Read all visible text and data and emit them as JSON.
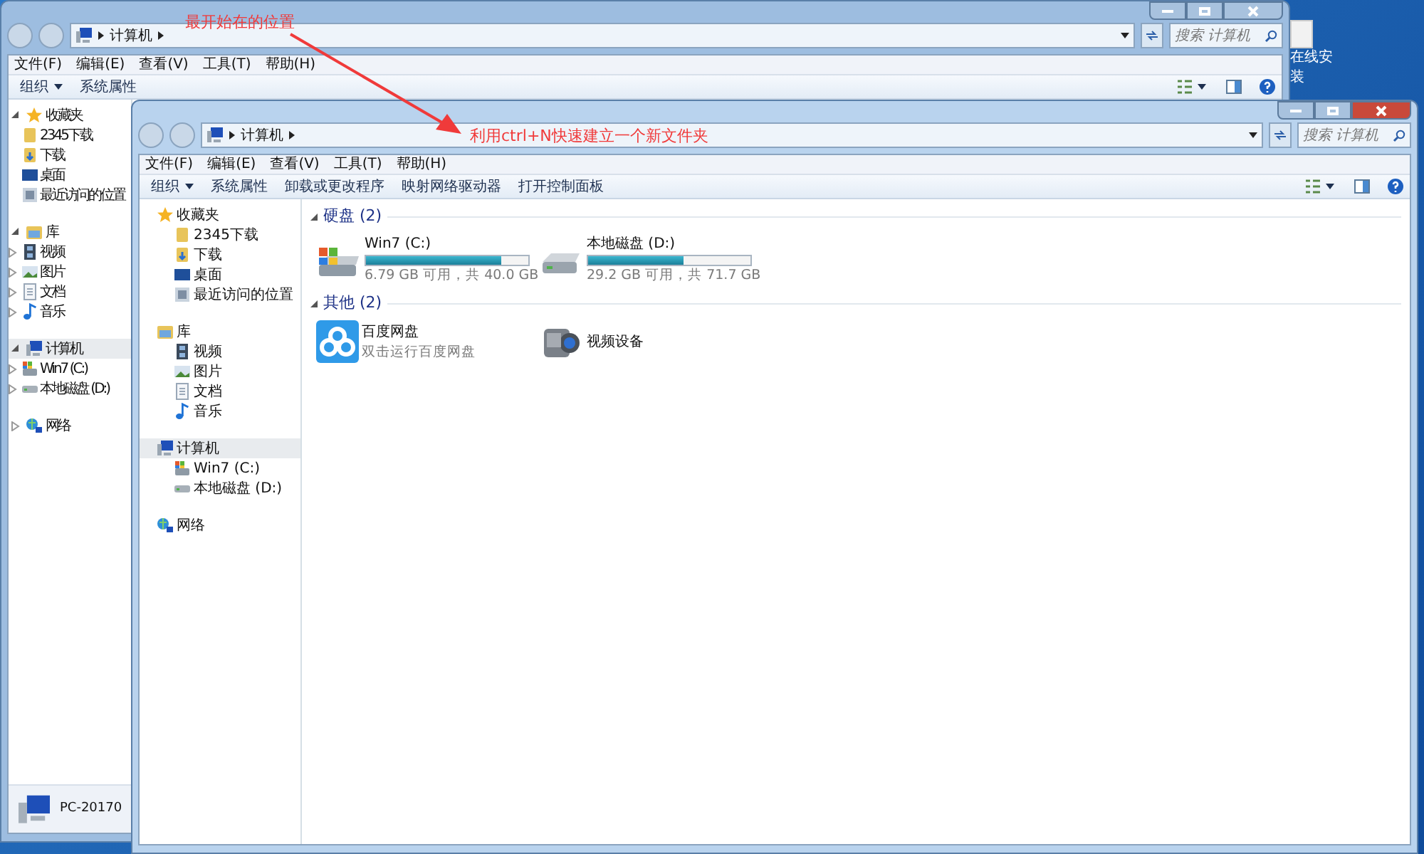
{
  "desktop_icons": [
    {
      "label": "在线安装"
    }
  ],
  "windows": [
    {
      "active": false,
      "address": [
        "计算机"
      ],
      "search": {
        "placeholder": "搜索 计算机"
      },
      "menu": [
        "文件(F)",
        "编辑(E)",
        "查看(V)",
        "工具(T)",
        "帮助(H)"
      ],
      "toolbar": [
        {
          "label": "组织",
          "dropdown": true
        },
        {
          "label": "系统属性",
          "dropdown": false
        }
      ],
      "sidebar": [
        {
          "label": "收藏夹",
          "kind": "star",
          "expanded": true,
          "selected": false,
          "children": [
            {
              "label": "2345下载",
              "kind": "folder"
            },
            {
              "label": "下载",
              "kind": "download"
            },
            {
              "label": "桌面",
              "kind": "desktop"
            },
            {
              "label": "最近访问的位置",
              "kind": "recent"
            }
          ]
        },
        {
          "label": "库",
          "kind": "library",
          "expanded": true,
          "selected": false,
          "children": [
            {
              "label": "视频",
              "kind": "video",
              "expanded": false
            },
            {
              "label": "图片",
              "kind": "image",
              "expanded": false
            },
            {
              "label": "文档",
              "kind": "document",
              "expanded": false
            },
            {
              "label": "音乐",
              "kind": "music",
              "expanded": false
            }
          ]
        },
        {
          "label": "计算机",
          "kind": "computer",
          "expanded": true,
          "selected": true,
          "children": [
            {
              "label": "Win7 (C:)",
              "kind": "system-drive",
              "expanded": false
            },
            {
              "label": "本地磁盘 (D:)",
              "kind": "drive",
              "expanded": false
            }
          ]
        },
        {
          "label": "网络",
          "kind": "network",
          "expanded": false,
          "selected": false
        }
      ],
      "details": {
        "name": "PC-20170"
      }
    },
    {
      "active": true,
      "address": [
        "计算机"
      ],
      "search": {
        "placeholder": "搜索 计算机"
      },
      "menu": [
        "文件(F)",
        "编辑(E)",
        "查看(V)",
        "工具(T)",
        "帮助(H)"
      ],
      "toolbar": [
        {
          "label": "组织",
          "dropdown": true
        },
        {
          "label": "系统属性",
          "dropdown": false
        },
        {
          "label": "卸载或更改程序",
          "dropdown": false
        },
        {
          "label": "映射网络驱动器",
          "dropdown": false
        },
        {
          "label": "打开控制面板",
          "dropdown": false
        }
      ],
      "sidebar": [
        {
          "label": "收藏夹",
          "kind": "star",
          "selected": false,
          "children": [
            {
              "label": "2345下载",
              "kind": "folder"
            },
            {
              "label": "下载",
              "kind": "download"
            },
            {
              "label": "桌面",
              "kind": "desktop"
            },
            {
              "label": "最近访问的位置",
              "kind": "recent"
            }
          ]
        },
        {
          "label": "库",
          "kind": "library",
          "selected": false,
          "children": [
            {
              "label": "视频",
              "kind": "video"
            },
            {
              "label": "图片",
              "kind": "image"
            },
            {
              "label": "文档",
              "kind": "document"
            },
            {
              "label": "音乐",
              "kind": "music"
            }
          ]
        },
        {
          "label": "计算机",
          "kind": "computer",
          "selected": true,
          "children": [
            {
              "label": "Win7 (C:)",
              "kind": "system-drive"
            },
            {
              "label": "本地磁盘 (D:)",
              "kind": "drive"
            }
          ]
        },
        {
          "label": "网络",
          "kind": "network",
          "selected": false
        }
      ],
      "groups": [
        {
          "title": "硬盘 (2)",
          "items": [
            {
              "kind": "system-drive",
              "name": "Win7 (C:)",
              "level": 0.83,
              "info": "6.79 GB 可用，共 40.0 GB"
            },
            {
              "kind": "drive",
              "name": "本地磁盘 (D:)",
              "level": 0.59,
              "info": "29.2 GB 可用，共 71.7 GB"
            }
          ]
        },
        {
          "title": "其他 (2)",
          "items": [
            {
              "kind": "cloud",
              "name": "百度网盘",
              "info": "双击运行百度网盘"
            },
            {
              "kind": "camera",
              "name": "视频设备"
            }
          ]
        }
      ]
    }
  ],
  "annotations": [
    {
      "kind": "arrow",
      "text": "最开始在的位置"
    },
    {
      "kind": "note",
      "text": "利用ctrl+N快速建立一个新文件夹"
    }
  ]
}
